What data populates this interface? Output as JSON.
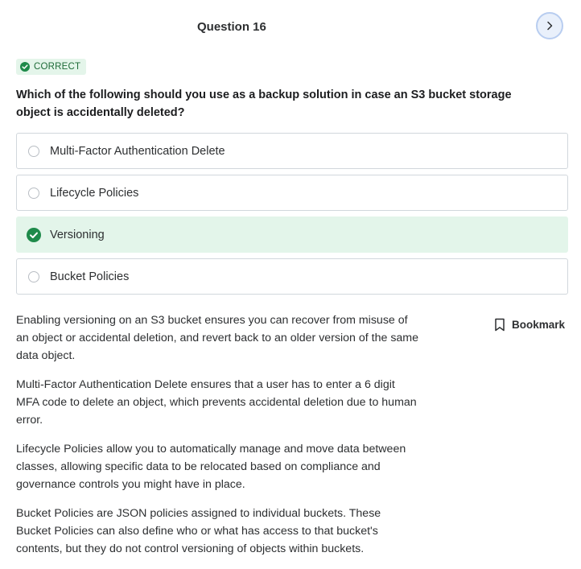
{
  "question": {
    "title": "Question 16",
    "status_label": "CORRECT",
    "text": "Which of the following should you use as a backup solution in case an S3 bucket storage object is accidentally deleted?"
  },
  "options": [
    {
      "label": "Multi-Factor Authentication Delete",
      "state": "unselected"
    },
    {
      "label": "Lifecycle Policies",
      "state": "unselected"
    },
    {
      "label": "Versioning",
      "state": "correct"
    },
    {
      "label": "Bucket Policies",
      "state": "unselected"
    }
  ],
  "explanation": [
    "Enabling versioning on an S3 bucket ensures you can recover from misuse of an object or accidental deletion, and revert back to an older version of the same data object.",
    "Multi-Factor Authentication Delete ensures that a user has to enter a 6 digit MFA code to delete an object, which prevents accidental deletion due to human error.",
    "Lifecycle Policies allow you to automatically manage and move data between classes, allowing specific data to be relocated based on compliance and governance controls you might have in place.",
    "Bucket Policies are JSON policies assigned to individual buckets. These Bucket Policies can also define who or what has access to that bucket's contents, but they do not control versioning of objects within buckets."
  ],
  "bookmark": {
    "label": "Bookmark"
  },
  "icons": {
    "next": "chevron-right-icon",
    "correct": "check-circle-icon",
    "bookmark": "bookmark-icon"
  },
  "colors": {
    "correct_green": "#1e8a4a",
    "correct_bg": "#e3f5ea",
    "next_button_bg": "#e9f0fb"
  }
}
